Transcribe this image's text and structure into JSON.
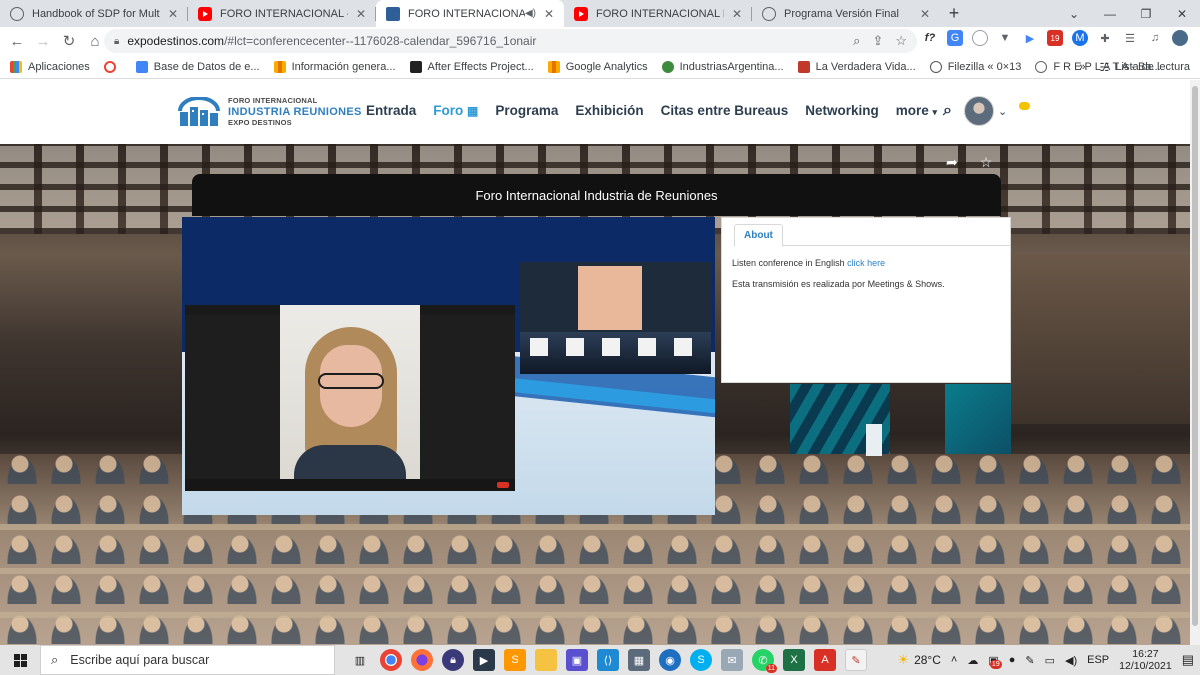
{
  "browser": {
    "tabs": [
      {
        "title": "Handbook of SDP for Multimedia",
        "favicon": "globe-icon",
        "active": false
      },
      {
        "title": "FORO INTERNACIONAL - Industria",
        "favicon": "youtube-icon",
        "active": false
      },
      {
        "title": "FORO INTERNACIONAL DE L",
        "favicon": "foro-icon",
        "active": true,
        "audio": true
      },
      {
        "title": "FORO INTERNACIONAL INDUSTRIA",
        "favicon": "youtube-icon",
        "active": false
      },
      {
        "title": "Programa Versión Final",
        "favicon": "globe-icon",
        "active": false
      }
    ],
    "url_host": "expodestinos.com",
    "url_path": "/#lct=conferencecenter--1176028-calendar_596716_1onair",
    "bookmarks": [
      {
        "label": "Aplicaciones",
        "icon": "apps-grid-icon"
      },
      {
        "label": "",
        "icon": "google-icon"
      },
      {
        "label": "Base de Datos de e...",
        "icon": "puzzle-icon"
      },
      {
        "label": "Información genera...",
        "icon": "analytics-icon"
      },
      {
        "label": "After Effects Project...",
        "icon": "ae-icon"
      },
      {
        "label": "Google Analytics",
        "icon": "analytics-icon"
      },
      {
        "label": "IndustriasArgentina...",
        "icon": "globe-icon"
      },
      {
        "label": "La Verdadera Vida...",
        "icon": "tlv-icon"
      },
      {
        "label": "Filezilla « 0×13",
        "icon": "wordpress-icon"
      },
      {
        "label": "F R E P L A T A - Ba...",
        "icon": "globe-icon"
      }
    ],
    "bookmarks_more": "»",
    "reading_list": "Lista de lectura"
  },
  "site": {
    "logo": {
      "line1": "FORO INTERNACIONAL",
      "line2": "INDUSTRIA REUNIONES",
      "line3": "EXPO DESTINOS"
    },
    "nav": [
      "Entrada",
      "Foro",
      "Programa",
      "Exhibición",
      "Citas entre Bureaus",
      "Networking",
      "more"
    ],
    "active_nav": "Foro"
  },
  "stage": {
    "title": "Foro Internacional Industria de Reuniones",
    "about_tab": "About",
    "about_line1_prefix": "Listen conference in English ",
    "about_line1_link": "click here",
    "about_line2": "Esta transmisión es realizada por Meetings & Shows."
  },
  "taskbar": {
    "search_placeholder": "Escribe aquí para buscar",
    "weather": "28°C",
    "language": "ESP",
    "time": "16:27",
    "date": "12/10/2021",
    "badges": {
      "teams": "19",
      "whatsapp": "11"
    }
  },
  "colors": {
    "accent": "#2f9bd6",
    "nav_text": "#2d3e4f",
    "stage_bar": "#111111",
    "video_bg": "#0b2a66"
  }
}
